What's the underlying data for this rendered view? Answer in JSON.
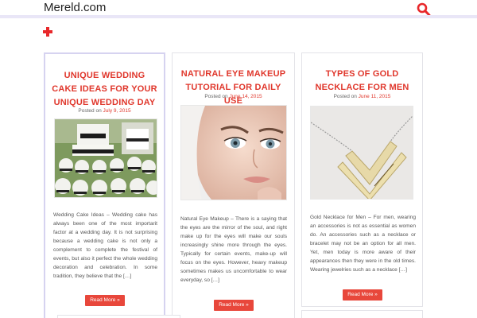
{
  "site": {
    "title": "Mereld.com"
  },
  "header": {
    "search_icon": "search-icon",
    "menu_icon": "plus-icon",
    "accent": "#e8282b"
  },
  "posts": [
    {
      "title": "Unique Wedding Cake Ideas For Your Unique Wedding Day",
      "posted_label": "Posted on",
      "date": "July 9, 2015",
      "excerpt": "Wedding Cake Ideas – Wedding cake has always been one of the most importarit factor at a wedding day. It is not surprising because a wedding cake is not only a complement to complete the festival of events, but also it perfect the whole wedding decoration and celebration. In some tradition, they believe that the […]",
      "read_more": "Read More »"
    },
    {
      "title": "Natural Eye Makeup Tutorial For Daily Use",
      "posted_label": "Posted on",
      "date": "June 14, 2015",
      "excerpt": "Natural Eye Makeup – There is a saying that the eyes are the mirror of the soul, and right make up for the eyes will make our souls increasingly shine more through the eyes. Typically for certain events, make-up will focus on the eyes. However, heavy makeup sometimes makes us uncomfortable to wear everyday, so […]",
      "read_more": "Read More »"
    },
    {
      "title": "Types Of Gold Necklace For Men",
      "posted_label": "Posted on",
      "date": "June 11, 2015",
      "excerpt": "Gold Necklace for Men – For men, wearing an accessories is not as essential as women do. An accessories such as a necklace or bracelet may not be an option for all men. Yet, men today is more aware of their appearances then they were in the old times. Wearing jewelries such as a necklace […]",
      "read_more": "Read More »"
    }
  ]
}
